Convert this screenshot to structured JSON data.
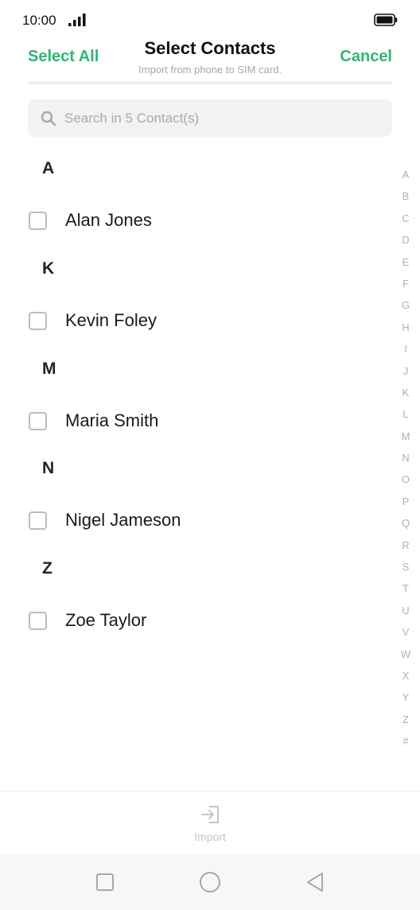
{
  "status_bar": {
    "time": "10:00",
    "signal_icon": "signal-bars-icon",
    "battery_icon": "battery-full-icon"
  },
  "header": {
    "select_all_label": "Select All",
    "title": "Select Contacts",
    "subtitle": "Import from phone to SIM card.",
    "cancel_label": "Cancel",
    "accent_color": "#2bb673"
  },
  "search": {
    "placeholder": "Search in 5 Contact(s)",
    "value": "",
    "icon": "search-icon"
  },
  "sections": [
    {
      "letter": "A",
      "contacts": [
        {
          "name": "Alan Jones",
          "checked": false
        }
      ]
    },
    {
      "letter": "K",
      "contacts": [
        {
          "name": "Kevin Foley",
          "checked": false
        }
      ]
    },
    {
      "letter": "M",
      "contacts": [
        {
          "name": "Maria Smith",
          "checked": false
        }
      ]
    },
    {
      "letter": "N",
      "contacts": [
        {
          "name": "Nigel Jameson",
          "checked": false
        }
      ]
    },
    {
      "letter": "Z",
      "contacts": [
        {
          "name": "Zoe Taylor",
          "checked": false
        }
      ]
    }
  ],
  "alphabet_index": [
    "A",
    "B",
    "C",
    "D",
    "E",
    "F",
    "G",
    "H",
    "I",
    "J",
    "K",
    "L",
    "M",
    "N",
    "O",
    "P",
    "Q",
    "R",
    "S",
    "T",
    "U",
    "V",
    "W",
    "X",
    "Y",
    "Z",
    "#"
  ],
  "toolbar": {
    "import_label": "Import",
    "import_icon": "import-icon"
  },
  "nav_bar": {
    "recents_icon": "square-recents-icon",
    "home_icon": "circle-home-icon",
    "back_icon": "triangle-back-icon"
  }
}
